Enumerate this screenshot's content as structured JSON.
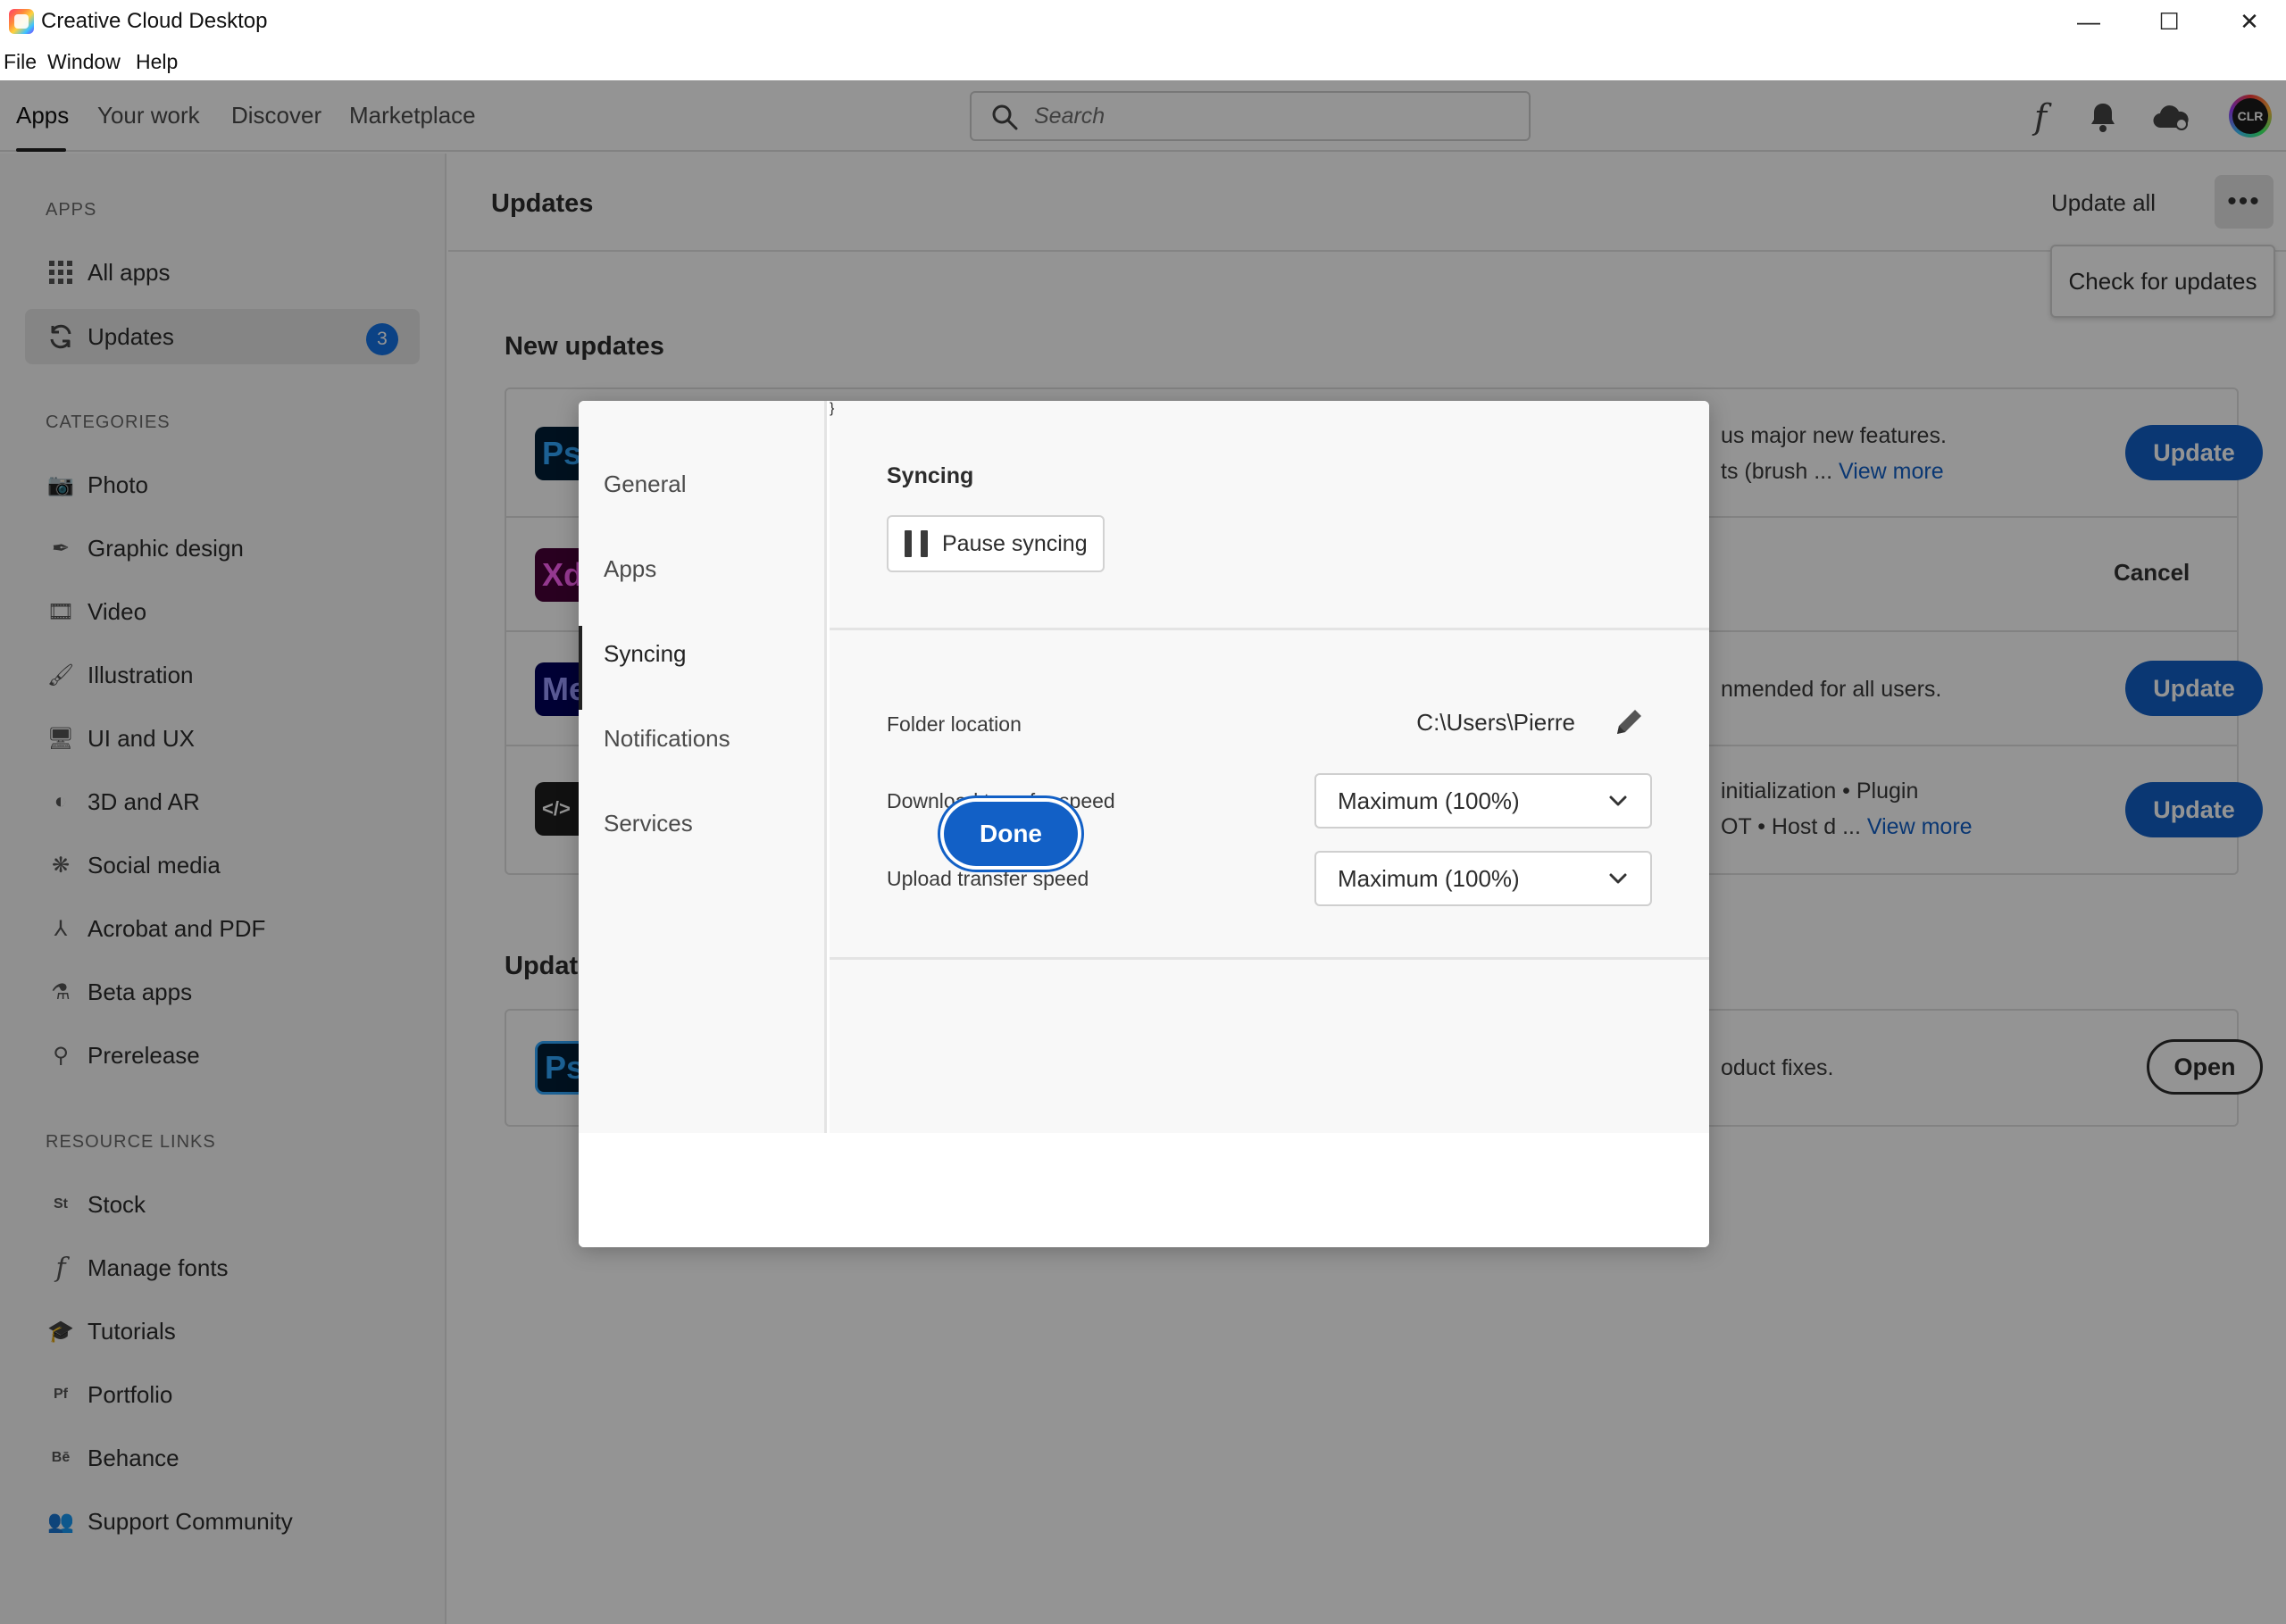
{
  "window": {
    "title": "Creative Cloud Desktop",
    "minimize_glyph": "—",
    "maximize_glyph": "☐",
    "close_glyph": "✕"
  },
  "menu": {
    "file": "File",
    "window": "Window",
    "help": "Help"
  },
  "nav": {
    "tabs": [
      "Apps",
      "Your work",
      "Discover",
      "Marketplace"
    ],
    "active_tab": "Apps",
    "search_placeholder": "Search",
    "fonts_glyph": "f",
    "avatar_text": "CLR"
  },
  "sidebar": {
    "apps_heading": "APPS",
    "apps_items": [
      {
        "label": "All apps",
        "icon": "grid-icon"
      },
      {
        "label": "Updates",
        "icon": "refresh-icon",
        "badge": "3",
        "selected": true
      }
    ],
    "categories_heading": "CATEGORIES",
    "categories": [
      {
        "label": "Photo",
        "icon": "camera-icon"
      },
      {
        "label": "Graphic design",
        "icon": "pen-tool-icon"
      },
      {
        "label": "Video",
        "icon": "film-icon"
      },
      {
        "label": "Illustration",
        "icon": "brush-icon"
      },
      {
        "label": "UI and UX",
        "icon": "devices-icon"
      },
      {
        "label": "3D and AR",
        "icon": "sphere-icon"
      },
      {
        "label": "Social media",
        "icon": "social-icon"
      },
      {
        "label": "Acrobat and PDF",
        "icon": "acrobat-icon"
      },
      {
        "label": "Beta apps",
        "icon": "flask-icon"
      },
      {
        "label": "Prerelease",
        "icon": "prerelease-icon"
      }
    ],
    "resources_heading": "RESOURCE LINKS",
    "resources": [
      {
        "label": "Stock",
        "icon": "stock-icon",
        "glyph": "St"
      },
      {
        "label": "Manage fonts",
        "icon": "font-icon",
        "glyph": "f"
      },
      {
        "label": "Tutorials",
        "icon": "graduation-cap-icon",
        "glyph": "🎓"
      },
      {
        "label": "Portfolio",
        "icon": "portfolio-icon",
        "glyph": "Pf"
      },
      {
        "label": "Behance",
        "icon": "behance-icon",
        "glyph": "Bē"
      },
      {
        "label": "Support Community",
        "icon": "community-icon",
        "glyph": "👥"
      }
    ]
  },
  "main": {
    "title": "Updates",
    "update_all": "Update all",
    "more_glyph": "•••",
    "check_for_updates": "Check for updates",
    "new_updates_heading": "New updates",
    "updates_heading_partial": "Update",
    "rows": [
      {
        "tile": "Ps",
        "desc_line1": "us major new features.",
        "desc_line2": "ts (brush ...",
        "link": "View more",
        "action": "Update"
      },
      {
        "tile": "Xd",
        "action": "Cancel"
      },
      {
        "tile": "Me",
        "desc_line1": "nmended for all users.",
        "action": "Update"
      },
      {
        "tile": "</>",
        "desc_line1": "initialization • Plugin",
        "desc_line2": "OT • Host d ...",
        "link": "View more",
        "action": "Update"
      }
    ],
    "installed_row": {
      "tile": "Ps",
      "desc_line1": "oduct fixes.",
      "action": "Open"
    }
  },
  "dialog": {
    "nav": [
      "General",
      "Apps",
      "Syncing",
      "Notifications",
      "Services"
    ],
    "active_nav": "Syncing",
    "section_title": "Syncing",
    "pause_label": "Pause syncing",
    "folder_label": "Folder location",
    "folder_value": "C:\\Users\\Pierre",
    "download_label": "Download transfer speed",
    "download_value": "Maximum (100%)",
    "upload_label": "Upload transfer speed",
    "upload_value": "Maximum (100%)",
    "done_label": "Done"
  },
  "colors": {
    "accent_blue": "#1260c6",
    "badge_blue": "#1473e6",
    "ps_tile": "#001e36",
    "ps_text": "#31a8ff",
    "xd_tile": "#470137",
    "xd_text": "#ff61f6",
    "me_tile": "#00005b",
    "me_text": "#9999ff",
    "dev_tile": "#1e1e1e",
    "dev_text": "#ffffff"
  }
}
